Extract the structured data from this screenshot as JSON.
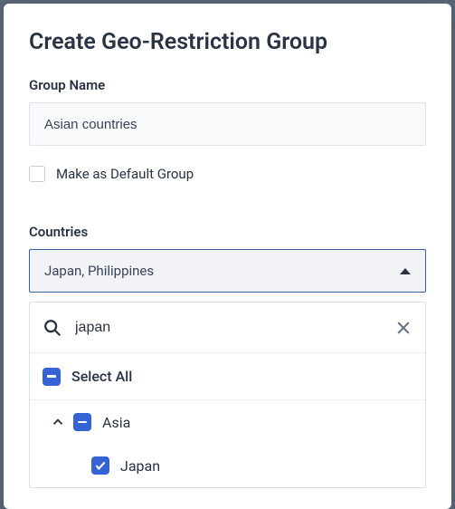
{
  "dialog": {
    "title": "Create Geo-Restriction Group",
    "groupNameLabel": "Group Name",
    "groupNameValue": "Asian countries",
    "defaultGroupLabel": "Make as Default Group",
    "countriesLabel": "Countries",
    "countriesSelected": "Japan, Philippines"
  },
  "dropdown": {
    "searchValue": "japan",
    "selectAllLabel": "Select All",
    "region": {
      "name": "Asia"
    },
    "countries": [
      {
        "name": "Japan"
      }
    ]
  }
}
